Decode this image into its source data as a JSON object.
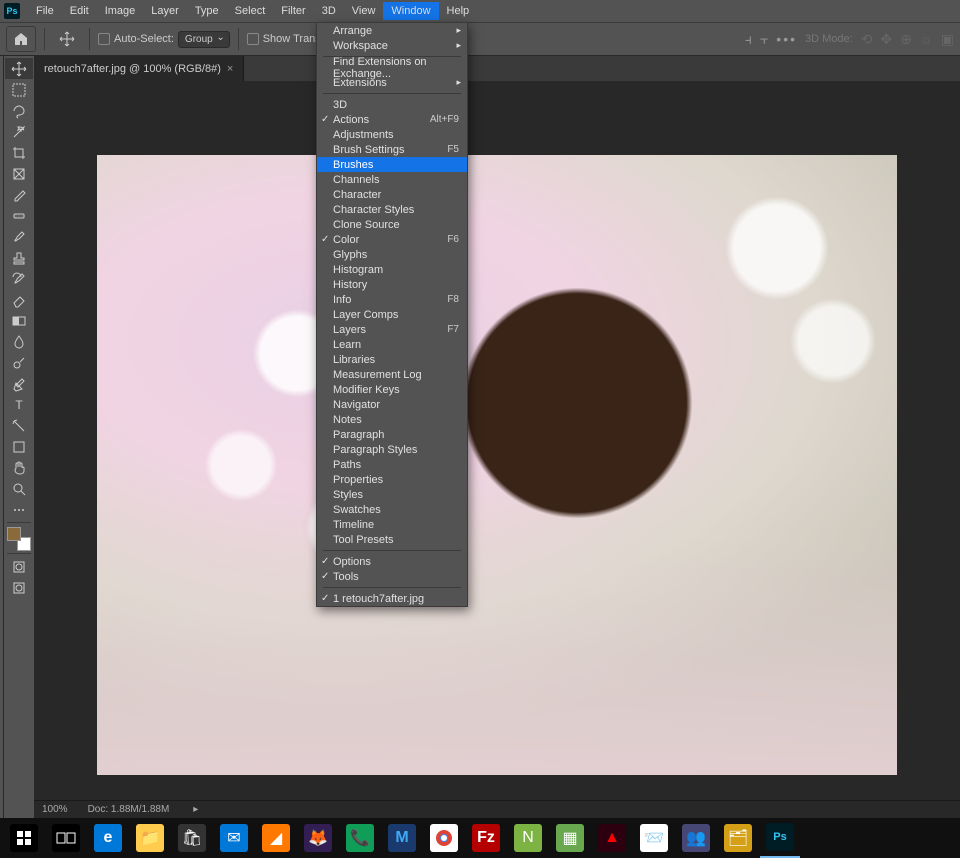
{
  "app_icon": "Ps",
  "menubar": [
    "File",
    "Edit",
    "Image",
    "Layer",
    "Type",
    "Select",
    "Filter",
    "3D",
    "View",
    "Window",
    "Help"
  ],
  "menubar_open_index": 9,
  "options": {
    "auto_select": "Auto-Select:",
    "group": "Group",
    "transform": "Show Transform Controls",
    "modes": "3D Mode:"
  },
  "doc_tab": "retouch7after.jpg @ 100% (RGB/8#)",
  "dropdown": {
    "groups": [
      {
        "items": [
          {
            "label": "Arrange",
            "sub": true
          },
          {
            "label": "Workspace",
            "sub": true
          }
        ]
      },
      {
        "items": [
          {
            "label": "Find Extensions on Exchange..."
          },
          {
            "label": "Extensions",
            "sub": true
          }
        ]
      },
      {
        "items": [
          {
            "label": "3D"
          },
          {
            "label": "Actions",
            "shortcut": "Alt+F9",
            "checked": true
          },
          {
            "label": "Adjustments"
          },
          {
            "label": "Brush Settings",
            "shortcut": "F5"
          },
          {
            "label": "Brushes",
            "highlighted": true
          },
          {
            "label": "Channels"
          },
          {
            "label": "Character"
          },
          {
            "label": "Character Styles"
          },
          {
            "label": "Clone Source"
          },
          {
            "label": "Color",
            "shortcut": "F6",
            "checked": true
          },
          {
            "label": "Glyphs"
          },
          {
            "label": "Histogram"
          },
          {
            "label": "History"
          },
          {
            "label": "Info",
            "shortcut": "F8"
          },
          {
            "label": "Layer Comps"
          },
          {
            "label": "Layers",
            "shortcut": "F7"
          },
          {
            "label": "Learn"
          },
          {
            "label": "Libraries"
          },
          {
            "label": "Measurement Log"
          },
          {
            "label": "Modifier Keys"
          },
          {
            "label": "Navigator"
          },
          {
            "label": "Notes"
          },
          {
            "label": "Paragraph"
          },
          {
            "label": "Paragraph Styles"
          },
          {
            "label": "Paths"
          },
          {
            "label": "Properties"
          },
          {
            "label": "Styles"
          },
          {
            "label": "Swatches"
          },
          {
            "label": "Timeline"
          },
          {
            "label": "Tool Presets"
          }
        ]
      },
      {
        "items": [
          {
            "label": "Options",
            "checked": true
          },
          {
            "label": "Tools",
            "checked": true
          }
        ]
      },
      {
        "items": [
          {
            "label": "1 retouch7after.jpg",
            "checked": true
          }
        ]
      }
    ]
  },
  "status": {
    "zoom": "100%",
    "doc": "Doc: 1.88M/1.88M"
  },
  "tools": [
    "move",
    "marquee",
    "lasso",
    "wand",
    "crop",
    "frame",
    "eyedropper",
    "heal",
    "brush",
    "stamp",
    "history-brush",
    "eraser",
    "gradient",
    "blur",
    "dodge",
    "pen",
    "type",
    "path",
    "shape",
    "hand",
    "zoom",
    "dots"
  ],
  "taskbar": [
    "start",
    "taskview",
    "edge",
    "explorer",
    "store",
    "mail",
    "avast",
    "firefox",
    "voice",
    "malware",
    "chrome",
    "filezilla",
    "notepad",
    "sheets",
    "adobe",
    "outlook",
    "teams",
    "ftp",
    "ps"
  ]
}
